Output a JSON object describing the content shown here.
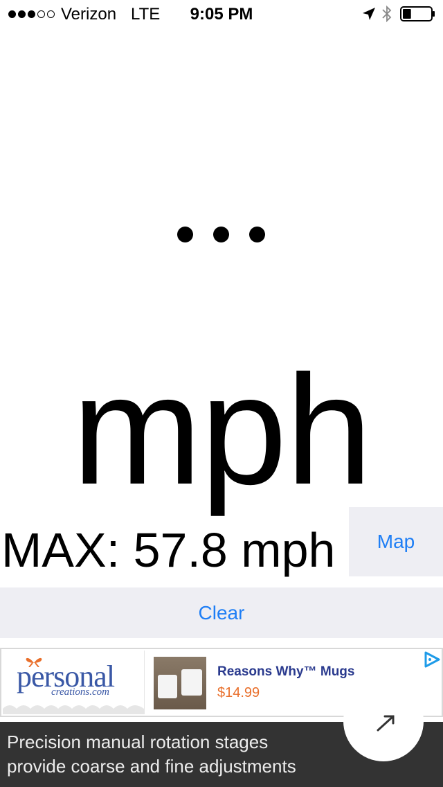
{
  "status_bar": {
    "carrier": "Verizon",
    "network": "LTE",
    "time": "9:05 PM",
    "signal_bars_filled": 3,
    "signal_bars_total": 5,
    "icons": [
      "location-arrow-icon",
      "bluetooth-icon",
      "battery-icon"
    ],
    "battery_level": 0.3
  },
  "speed": {
    "unit": "mph"
  },
  "max": {
    "text": "MAX: 57.8 mph"
  },
  "buttons": {
    "map": "Map",
    "clear": "Clear"
  },
  "ad": {
    "brand_logo": "personal creations.com",
    "title": "Reasons Why™ Mugs",
    "price": "$14.99",
    "choices_icon": "adchoices-icon"
  },
  "bottom_banner": {
    "text_line1": "Precision manual rotation stages",
    "text_line2": "provide coarse and fine adjustments",
    "icon": "arrow-icon"
  },
  "colors": {
    "accent": "#1e7ef5",
    "button_bg": "#eeeef3",
    "ad_title": "#2a3a8e",
    "ad_price": "#e96f2b",
    "banner_bg": "#333333"
  }
}
